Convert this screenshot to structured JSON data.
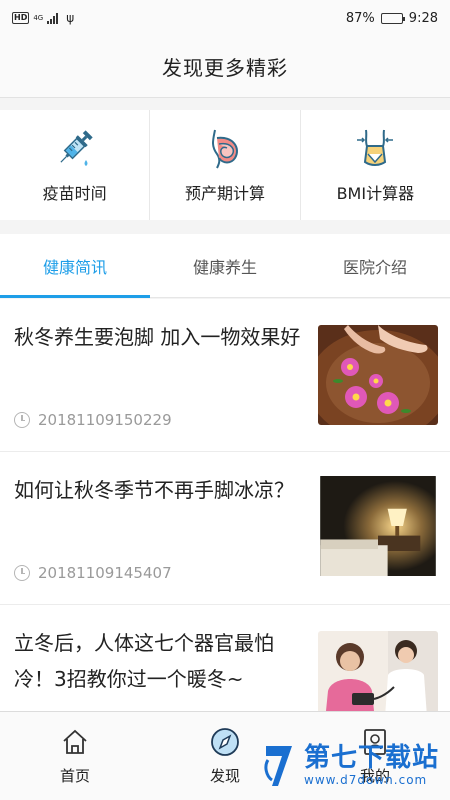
{
  "status_bar": {
    "left_badge": "HD",
    "network": "4G",
    "battery": "87%",
    "battery_level": 0.87,
    "time": "9:28"
  },
  "header": {
    "title": "发现更多精彩"
  },
  "tools": [
    {
      "label": "疫苗时间",
      "icon": "syringe-icon"
    },
    {
      "label": "预产期计算",
      "icon": "pregnancy-icon"
    },
    {
      "label": "BMI计算器",
      "icon": "body-measure-icon"
    }
  ],
  "tabs": [
    {
      "label": "健康简讯",
      "active": true
    },
    {
      "label": "健康养生",
      "active": false
    },
    {
      "label": "医院介绍",
      "active": false
    }
  ],
  "articles": [
    {
      "title": "秋冬养生要泡脚 加入一物效果好",
      "time": "20181109150229",
      "thumb": "foot-soak-flowers"
    },
    {
      "title": "如何让秋冬季节不再手脚冰凉？",
      "time": "20181109145407",
      "thumb": "bedroom-lamp"
    },
    {
      "title": "立冬后，人体这七个器官最怕冷！3招教你过一个暖冬~",
      "time": "",
      "thumb": "blood-pressure-check"
    }
  ],
  "bottom_nav": [
    {
      "label": "首页",
      "icon": "home-icon"
    },
    {
      "label": "发现",
      "icon": "compass-icon"
    },
    {
      "label": "我的",
      "icon": "profile-icon"
    }
  ],
  "watermark": {
    "main": "第七下载站",
    "sub": "www.d7down.com"
  },
  "colors": {
    "accent": "#1e9ee8",
    "watermark": "#1a6fd0"
  }
}
